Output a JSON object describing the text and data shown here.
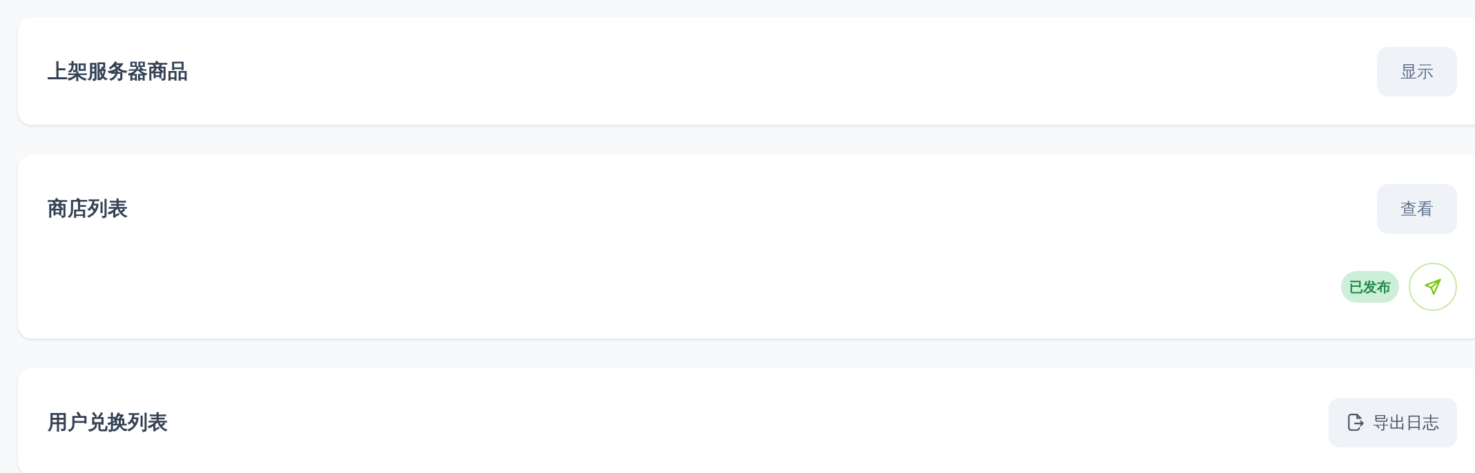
{
  "cards": [
    {
      "title": "上架服务器商品",
      "button": {
        "label": "显示",
        "kind": "plain"
      }
    },
    {
      "title": "商店列表",
      "button": {
        "label": "查看",
        "kind": "plain"
      },
      "footer": {
        "status": "已发布",
        "published": true
      }
    },
    {
      "title": "用户兑换列表",
      "button": {
        "label": "导出日志",
        "kind": "export"
      }
    }
  ]
}
